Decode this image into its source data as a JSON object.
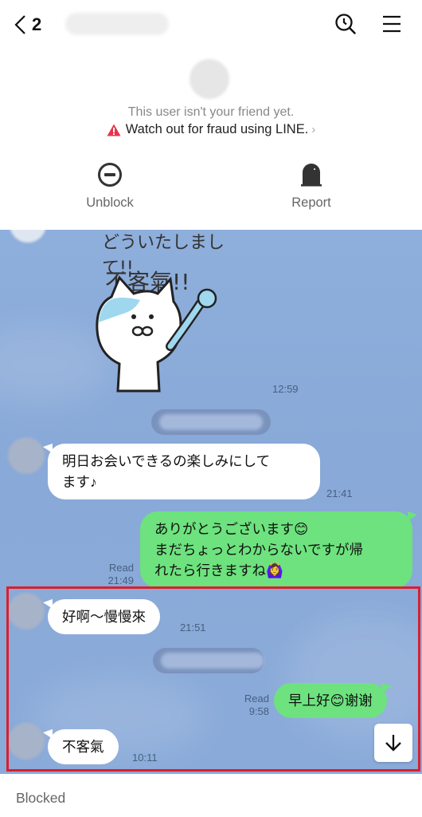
{
  "header": {
    "back_count": "2",
    "contact_name_redacted": true,
    "icons": {
      "back": "chevron-left-icon",
      "search": "search-history-icon",
      "menu": "hamburger-menu-icon"
    }
  },
  "notice": {
    "not_friend_text": "This user isn't your friend yet.",
    "fraud_warning_text": "Watch out for fraud using LINE.",
    "fraud_chevron": "›",
    "actions": [
      {
        "label": "Unblock",
        "icon": "unblock-icon"
      },
      {
        "label": "Report",
        "icon": "report-icon"
      }
    ]
  },
  "colors": {
    "chat_background": "#89a9d8",
    "outgoing_bubble": "#6de27e",
    "incoming_bubble": "#ffffff",
    "warning_red": "#e8344a",
    "highlight_border": "#dc1f2c"
  },
  "messages": [
    {
      "direction": "in",
      "type": "sticker",
      "sticker_text_line1": "どういたしまして!!",
      "sticker_text_line2": "不客氣!!",
      "time": "12:59"
    },
    {
      "direction": "system",
      "type": "date",
      "text_redacted": true
    },
    {
      "direction": "in",
      "type": "text",
      "text_line1": "明日お会いできるの楽しみにして",
      "text_line2": "ます♪",
      "time": "21:41"
    },
    {
      "direction": "out",
      "type": "text",
      "text_line1": "ありがとうございます😊",
      "text_line2": "まだちょっとわからないですが帰",
      "text_line3": "れたら行きますね🙆‍♀️",
      "read": "Read",
      "time": "21:49"
    },
    {
      "direction": "in",
      "type": "text",
      "text": "好啊～慢慢來",
      "time": "21:51"
    },
    {
      "direction": "system",
      "type": "date",
      "text_redacted": true
    },
    {
      "direction": "out",
      "type": "text",
      "text": "早上好😊谢谢",
      "read": "Read",
      "time": "9:58"
    },
    {
      "direction": "in",
      "type": "text",
      "text": "不客氣",
      "time": "10:11"
    }
  ],
  "scroll_to_bottom_icon": "arrow-down-icon",
  "footer": {
    "status": "Blocked"
  }
}
